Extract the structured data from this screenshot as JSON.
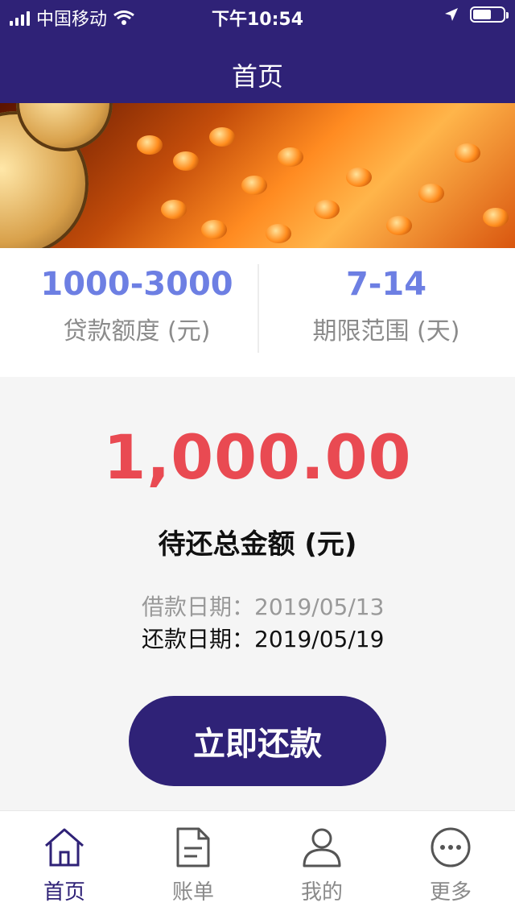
{
  "status_bar": {
    "carrier": "中国移动",
    "time": "下午10:54"
  },
  "navbar": {
    "title": "首页"
  },
  "stats": {
    "amount_range": {
      "value": "1000-3000",
      "label": "贷款额度 (元)"
    },
    "term_range": {
      "value": "7-14",
      "label": "期限范围 (天)"
    }
  },
  "repayment": {
    "total_amount": "1,000.00",
    "total_label": "待还总金额 (元)",
    "borrow_date_label": "借款日期：",
    "borrow_date": "2019/05/13",
    "repay_date_label": "还款日期：",
    "repay_date": "2019/05/19",
    "button_label": "立即还款"
  },
  "tabs": [
    {
      "label": "首页",
      "icon": "home-icon",
      "active": true
    },
    {
      "label": "账单",
      "icon": "bill-icon",
      "active": false
    },
    {
      "label": "我的",
      "icon": "user-icon",
      "active": false
    },
    {
      "label": "更多",
      "icon": "more-icon",
      "active": false
    }
  ],
  "colors": {
    "brand": "#2f2277",
    "amount": "#e94a52",
    "stat_value": "#6d7fe3"
  }
}
